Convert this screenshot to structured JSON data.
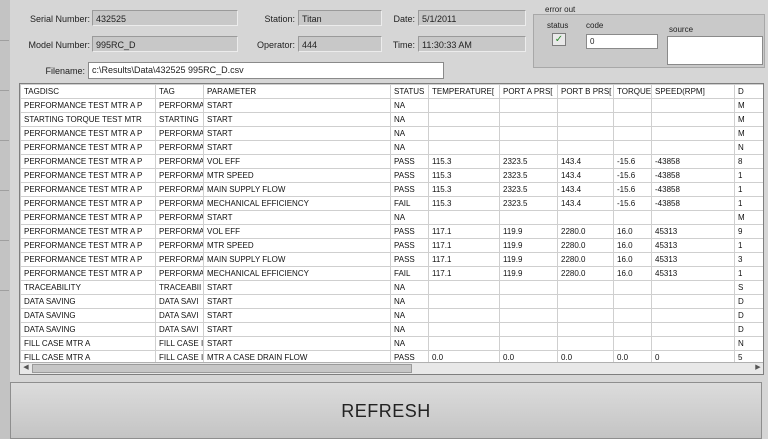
{
  "header": {
    "serial_label": "Serial Number:",
    "serial_value": "432525",
    "station_label": "Station:",
    "station_value": "Titan",
    "date_label": "Date:",
    "date_value": "5/1/2011",
    "model_label": "Model Number:",
    "model_value": "995RC_D",
    "operator_label": "Operator:",
    "operator_value": "444",
    "time_label": "Time:",
    "time_value": "11:30:33 AM",
    "filename_label": "Filename:",
    "filename_value": "c:\\Results\\Data\\432525 995RC_D.csv"
  },
  "error_out": {
    "title": "error out",
    "status_label": "status",
    "status_icon": "checkmark-icon",
    "status_color": "#2a8a2a",
    "code_label": "code",
    "code_value": "0",
    "source_label": "source",
    "source_value": ""
  },
  "table": {
    "columns": [
      "TAGDISC",
      "TAG",
      "PARAMETER",
      "STATUS",
      "TEMPERATURE[",
      "PORT A PRS[",
      "PORT B PRS[",
      "TORQUE",
      "SPEED(RPM]",
      "D"
    ],
    "rows": [
      [
        "PERFORMANCE TEST MTR A P",
        "PERFORMA",
        "START",
        "NA",
        "",
        "",
        "",
        "",
        "",
        "M"
      ],
      [
        "STARTING TORQUE TEST MTR",
        "STARTING",
        "START",
        "NA",
        "",
        "",
        "",
        "",
        "",
        "M"
      ],
      [
        "PERFORMANCE TEST MTR A P",
        "PERFORMA",
        "START",
        "NA",
        "",
        "",
        "",
        "",
        "",
        "M"
      ],
      [
        "PERFORMANCE TEST MTR A P",
        "PERFORMA",
        "START",
        "NA",
        "",
        "",
        "",
        "",
        "",
        "N"
      ],
      [
        "PERFORMANCE TEST MTR A P",
        "PERFORMA",
        "VOL EFF",
        "PASS",
        "115.3",
        "2323.5",
        "143.4",
        "-15.6",
        "-43858",
        "8"
      ],
      [
        "PERFORMANCE TEST MTR A P",
        "PERFORMA",
        "MTR SPEED",
        "PASS",
        "115.3",
        "2323.5",
        "143.4",
        "-15.6",
        "-43858",
        "1"
      ],
      [
        "PERFORMANCE TEST MTR A P",
        "PERFORMA",
        "MAIN SUPPLY FLOW",
        "PASS",
        "115.3",
        "2323.5",
        "143.4",
        "-15.6",
        "-43858",
        "1"
      ],
      [
        "PERFORMANCE TEST MTR A P",
        "PERFORMA",
        "MECHANICAL EFFICIENCY",
        "FAIL",
        "115.3",
        "2323.5",
        "143.4",
        "-15.6",
        "-43858",
        "1"
      ],
      [
        "PERFORMANCE TEST MTR A P",
        "PERFORMA",
        "START",
        "NA",
        "",
        "",
        "",
        "",
        "",
        "M"
      ],
      [
        "PERFORMANCE TEST MTR A P",
        "PERFORMA",
        "VOL EFF",
        "PASS",
        "117.1",
        "119.9",
        "2280.0",
        "16.0",
        "45313",
        "9"
      ],
      [
        "PERFORMANCE TEST MTR A P",
        "PERFORMA",
        "MTR SPEED",
        "PASS",
        "117.1",
        "119.9",
        "2280.0",
        "16.0",
        "45313",
        "1"
      ],
      [
        "PERFORMANCE TEST MTR A P",
        "PERFORMA",
        "MAIN SUPPLY FLOW",
        "PASS",
        "117.1",
        "119.9",
        "2280.0",
        "16.0",
        "45313",
        "3"
      ],
      [
        "PERFORMANCE TEST MTR A P",
        "PERFORMA",
        "MECHANICAL EFFICIENCY",
        "FAIL",
        "117.1",
        "119.9",
        "2280.0",
        "16.0",
        "45313",
        "1"
      ],
      [
        "TRACEABILITY",
        "TRACEABII",
        "START",
        "NA",
        "",
        "",
        "",
        "",
        "",
        "S"
      ],
      [
        "DATA SAVING",
        "DATA SAVI",
        "START",
        "NA",
        "",
        "",
        "",
        "",
        "",
        "D"
      ],
      [
        "DATA SAVING",
        "DATA SAVI",
        "START",
        "NA",
        "",
        "",
        "",
        "",
        "",
        "D"
      ],
      [
        "DATA SAVING",
        "DATA SAVI",
        "START",
        "NA",
        "",
        "",
        "",
        "",
        "",
        "D"
      ],
      [
        "FILL CASE MTR A",
        "FILL CASE I",
        "START",
        "NA",
        "",
        "",
        "",
        "",
        "",
        "N"
      ],
      [
        "FILL CASE MTR A",
        "FILL CASE I",
        "MTR A CASE DRAIN FLOW",
        "PASS",
        "0.0",
        "0.0",
        "0.0",
        "0.0",
        "0",
        "5"
      ]
    ]
  },
  "buttons": {
    "refresh_label": "REFRESH"
  }
}
